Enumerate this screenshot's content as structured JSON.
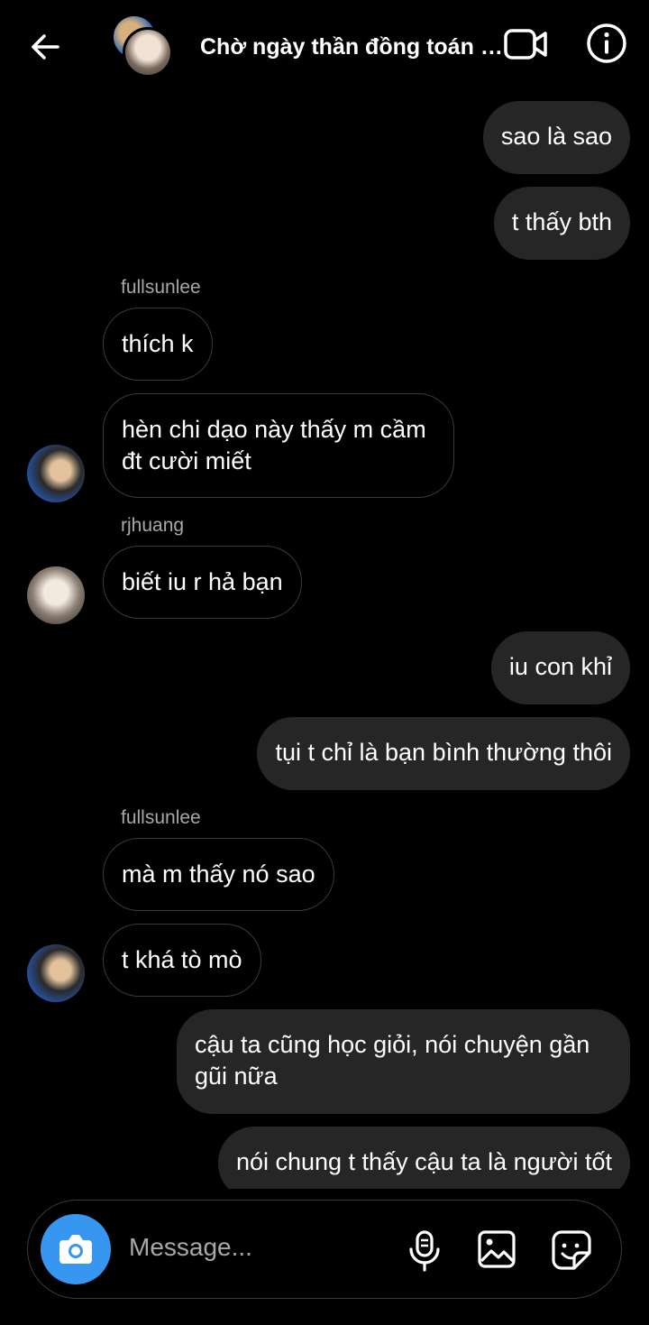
{
  "header": {
    "title": "Chờ ngày thần đồng toán h…",
    "icons": {
      "back": "arrow-left-icon",
      "video": "video-call-icon",
      "info": "info-icon"
    }
  },
  "messages": [
    {
      "type": "sent",
      "text": "sao là sao"
    },
    {
      "type": "sent",
      "text": "t thấy bth"
    },
    {
      "type": "sender",
      "text": "fullsunlee"
    },
    {
      "type": "received",
      "text": "thích k"
    },
    {
      "type": "received",
      "text": "hèn chi dạo này thấy m cầm đt cười miết"
    },
    {
      "type": "sender",
      "text": "rjhuang"
    },
    {
      "type": "received",
      "text": "biết iu r hả bạn"
    },
    {
      "type": "sent",
      "text": "iu con khỉ"
    },
    {
      "type": "sent",
      "text": "tụi t chỉ là bạn bình thường thôi"
    },
    {
      "type": "sender",
      "text": "fullsunlee"
    },
    {
      "type": "received",
      "text": "mà m thấy nó sao"
    },
    {
      "type": "received",
      "text": "t khá tò mò"
    },
    {
      "type": "sent",
      "text": "cậu ta cũng học giỏi, nói chuyện gần gũi nữa"
    },
    {
      "type": "sent",
      "text": "nói chung t thấy cậu ta là người tốt"
    }
  ],
  "composer": {
    "placeholder": "Message...",
    "icons": {
      "camera": "camera-icon",
      "mic": "microphone-icon",
      "gallery": "gallery-icon",
      "sticker": "sticker-icon"
    },
    "accent": "#3797f0"
  }
}
